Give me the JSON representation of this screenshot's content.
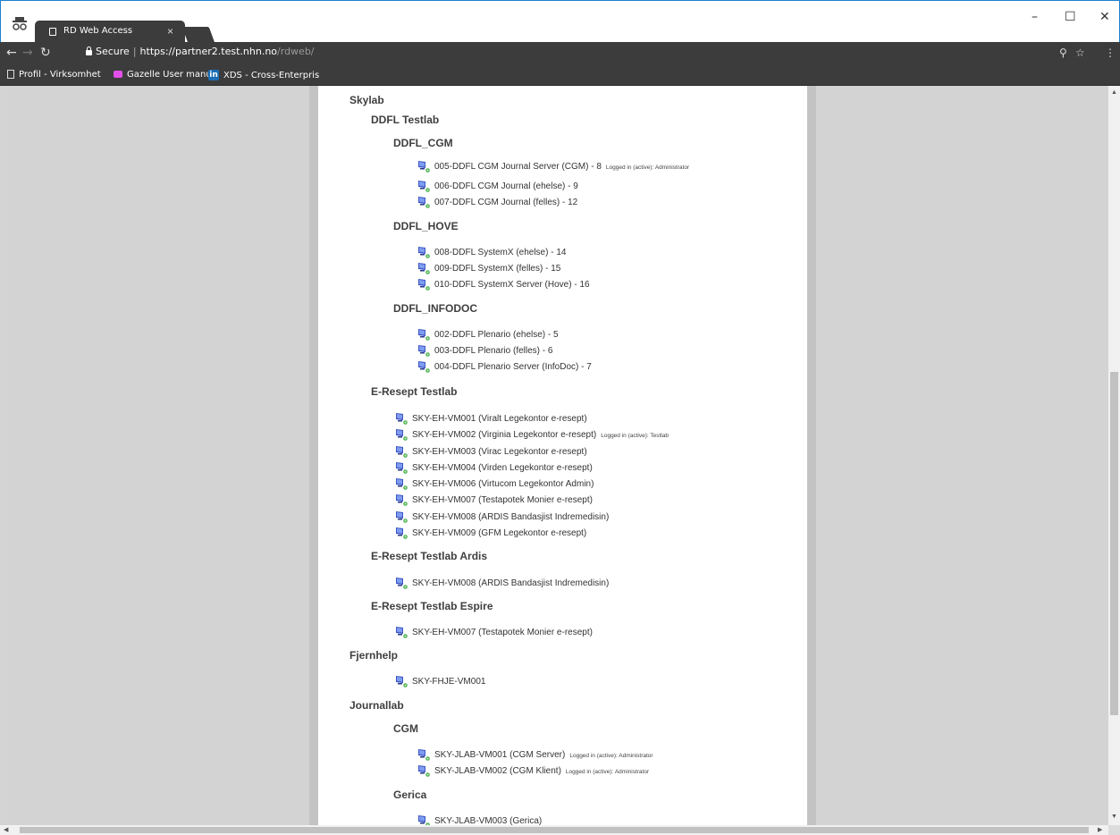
{
  "browser": {
    "tab_title": "RD Web Access",
    "tab_close": "×",
    "url_secure": "Secure",
    "url_host": "https://partner2.test.nhn.no",
    "url_path": "/rdweb/",
    "bookmarks": [
      {
        "label": "Profil - Virksomhet",
        "icon": "page-icon"
      },
      {
        "label": "Gazelle User manual",
        "icon": "gazelle-icon"
      },
      {
        "label": "XDS - Cross-Enterpris",
        "icon": "linkedin-icon"
      }
    ],
    "minimize": "–",
    "maximize": "☐",
    "close": "✕"
  },
  "groups": {
    "skylab": "Skylab",
    "ddfl_testlab": "DDFL Testlab",
    "ddfl_cgm": "DDFL_CGM",
    "ddfl_hove": "DDFL_HOVE",
    "ddfl_infodoc": "DDFL_INFODOC",
    "eresept_testlab": "E-Resept Testlab",
    "eresept_ardis": "E-Resept Testlab Ardis",
    "eresept_espire": "E-Resept Testlab Espire",
    "fjernhelp": "Fjernhelp",
    "journallab": "Journallab",
    "journallab_cgm": "CGM",
    "gerica": "Gerica"
  },
  "resources": {
    "cgm": [
      {
        "label": "005-DDFL CGM Journal Server (CGM) - 8",
        "status": "Logged in (active): Administrator"
      },
      {
        "label": "006-DDFL CGM Journal (ehelse) - 9",
        "status": ""
      },
      {
        "label": "007-DDFL CGM Journal (felles) - 12",
        "status": ""
      }
    ],
    "hove": [
      {
        "label": "008-DDFL SystemX (ehelse) - 14",
        "status": ""
      },
      {
        "label": "009-DDFL SystemX (felles) - 15",
        "status": ""
      },
      {
        "label": "010-DDFL SystemX Server (Hove) - 16",
        "status": ""
      }
    ],
    "infodoc": [
      {
        "label": "002-DDFL Plenario (ehelse) - 5",
        "status": ""
      },
      {
        "label": "003-DDFL Plenario (felles) - 6",
        "status": ""
      },
      {
        "label": "004-DDFL Plenario Server (InfoDoc) - 7",
        "status": ""
      }
    ],
    "eresept": [
      {
        "label": "SKY-EH-VM001 (Viralt Legekontor e-resept)",
        "status": ""
      },
      {
        "label": "SKY-EH-VM002 (Virginia Legekontor e-resept)",
        "status": "Logged in (active): Testlab"
      },
      {
        "label": "SKY-EH-VM003 (Virac Legekontor e-resept)",
        "status": ""
      },
      {
        "label": "SKY-EH-VM004 (Virden Legekontor e-resept)",
        "status": ""
      },
      {
        "label": "SKY-EH-VM006 (Virtucom Legekontor Admin)",
        "status": ""
      },
      {
        "label": "SKY-EH-VM007 (Testapotek Monier e-resept)",
        "status": ""
      },
      {
        "label": "SKY-EH-VM008 (ARDIS Bandasjist Indremedisin)",
        "status": ""
      },
      {
        "label": "SKY-EH-VM009 (GFM Legekontor e-resept)",
        "status": ""
      }
    ],
    "ardis": [
      {
        "label": "SKY-EH-VM008 (ARDIS Bandasjist Indremedisin)",
        "status": ""
      }
    ],
    "espire": [
      {
        "label": "SKY-EH-VM007 (Testapotek Monier e-resept)",
        "status": ""
      }
    ],
    "fjernhelp": [
      {
        "label": "SKY-FHJE-VM001",
        "status": ""
      }
    ],
    "jl_cgm": [
      {
        "label": "SKY-JLAB-VM001 (CGM Server)",
        "status": "Logged in (active): Administrator"
      },
      {
        "label": "SKY-JLAB-VM002 (CGM Klient)",
        "status": "Logged in (active): Administrator"
      }
    ],
    "gerica": [
      {
        "label": "SKY-JLAB-VM003 (Gerica)",
        "status": ""
      }
    ]
  }
}
